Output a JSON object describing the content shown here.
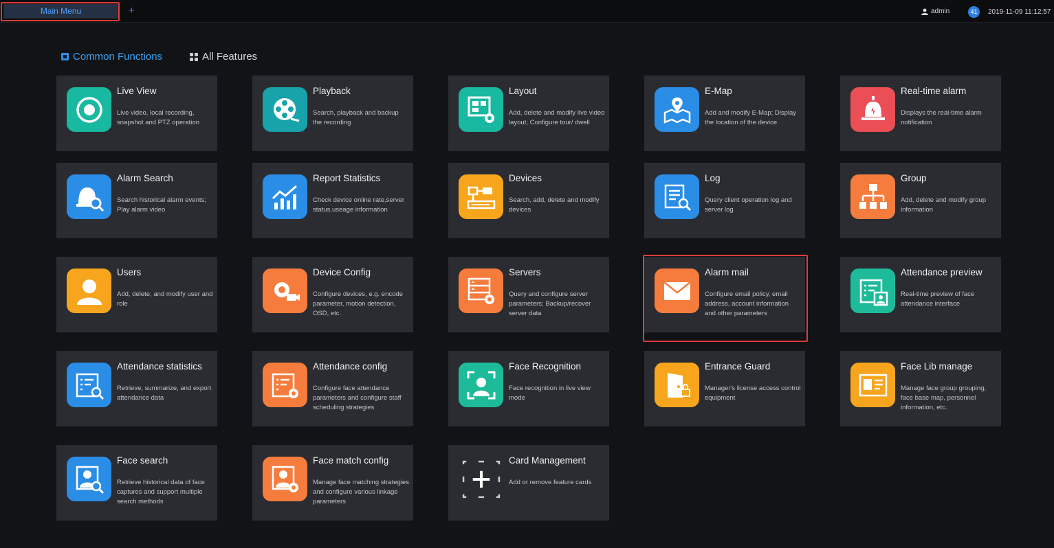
{
  "topbar": {
    "tab_label": "Main Menu",
    "add_tab": "+",
    "user": "admin",
    "notification_count": "41",
    "datetime": "2019-11-09 11:12:57"
  },
  "sections": {
    "common": "Common Functions",
    "all": "All Features"
  },
  "cards": [
    {
      "title": "Live View",
      "desc": "Live video, local recording, snapshot and PTZ operation",
      "icon": "live-view-icon",
      "color": "#19b8a0"
    },
    {
      "title": "Playback",
      "desc": "Search, playback and backup the recording",
      "icon": "playback-reel-icon",
      "color": "#17a3a9"
    },
    {
      "title": "Layout",
      "desc": "Add, delete and modify live video layout; Configure tour/ dwell",
      "icon": "layout-gear-icon",
      "color": "#19b8a0"
    },
    {
      "title": "E-Map",
      "desc": "Add and modify E-Map; Display the location of the device",
      "icon": "map-pin-icon",
      "color": "#2a8de6"
    },
    {
      "title": "Real-time alarm",
      "desc": "Displays the real-time alarm notification",
      "icon": "alarm-bell-icon",
      "color": "#ec4e55"
    },
    {
      "title": "Alarm Search",
      "desc": "Search historical alarm events; Play alarm video",
      "icon": "bell-search-icon",
      "color": "#2a8de6"
    },
    {
      "title": "Report Statistics",
      "desc": "Check device online rate,server status,useage information",
      "icon": "bar-chart-icon",
      "color": "#2a8de6"
    },
    {
      "title": "Devices",
      "desc": "Search, add, delete and modify devices",
      "icon": "devices-icon",
      "color": "#f7a51d"
    },
    {
      "title": "Log",
      "desc": "Query client operation log and server log",
      "icon": "log-search-icon",
      "color": "#2a8de6"
    },
    {
      "title": "Group",
      "desc": "Add, delete and modify group information",
      "icon": "group-tree-icon",
      "color": "#f57c3c"
    },
    {
      "title": "Users",
      "desc": "Add, delete, and modify user and role",
      "icon": "user-icon",
      "color": "#f7a51d"
    },
    {
      "title": "Device Config",
      "desc": "Configure devices, e.g. encode parameter, motion detection, OSD, etc.",
      "icon": "device-config-icon",
      "color": "#f57c3c"
    },
    {
      "title": "Servers",
      "desc": "Query and configure server parameters; Backup/recover server data",
      "icon": "server-gear-icon",
      "color": "#f57c3c"
    },
    {
      "title": "Alarm mail",
      "desc": "Configure email policy, email address, account information and other parameters",
      "icon": "envelope-icon",
      "color": "#f57c3c"
    },
    {
      "title": "Attendance preview",
      "desc": "Real-time preview of face attendance interface",
      "icon": "attendance-preview-icon",
      "color": "#1dbb9a"
    },
    {
      "title": "Attendance statistics",
      "desc": "Retrieve, summarize, and export attendance data",
      "icon": "calendar-search-icon",
      "color": "#2a8de6"
    },
    {
      "title": "Attendance config",
      "desc": "Configure face attendance parameters and configure staff scheduling strategies",
      "icon": "calendar-gear-icon",
      "color": "#f57c3c"
    },
    {
      "title": "Face Recognition",
      "desc": "Face recognition in live view mode",
      "icon": "face-scan-icon",
      "color": "#1dbb9a"
    },
    {
      "title": "Entrance Guard",
      "desc": "Manager's license access control equipment",
      "icon": "door-lock-icon",
      "color": "#f7a51d"
    },
    {
      "title": "Face Lib manage",
      "desc": "Manage face group grouping, face base map, personnel information, etc.",
      "icon": "id-card-icon",
      "color": "#f7a51d"
    },
    {
      "title": "Face search",
      "desc": "Retrieve historical data of face captures and support multiple search methods",
      "icon": "face-search-icon",
      "color": "#2a8de6"
    },
    {
      "title": "Face match config",
      "desc": "Manage face matching strategies and configure various linkage parameters",
      "icon": "face-gear-icon",
      "color": "#f57c3c"
    },
    {
      "title": "Card Management",
      "desc": "Add or remove feature cards",
      "icon": "add-card-icon",
      "color": ""
    }
  ]
}
